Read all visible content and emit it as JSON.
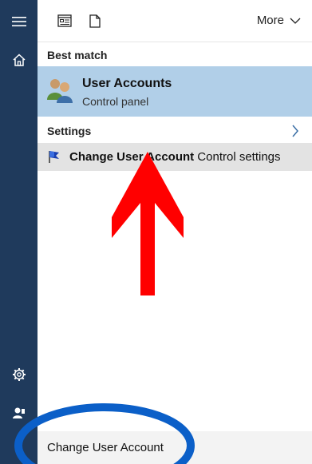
{
  "rail": {
    "icons": [
      "hamburger-menu-icon",
      "home-icon",
      "gear-icon",
      "user-icon"
    ]
  },
  "toolbar": {
    "more_label": "More"
  },
  "best_match": {
    "heading": "Best match",
    "title": "User Accounts",
    "subtitle": "Control panel"
  },
  "settings": {
    "heading": "Settings",
    "item": {
      "bold_text": "Change User Account",
      "rest_text": " Control settings"
    }
  },
  "search": {
    "query": "Change User Account"
  },
  "annotations": {
    "arrow_color": "#ff0000",
    "circle_color": "#0b5fc8"
  }
}
